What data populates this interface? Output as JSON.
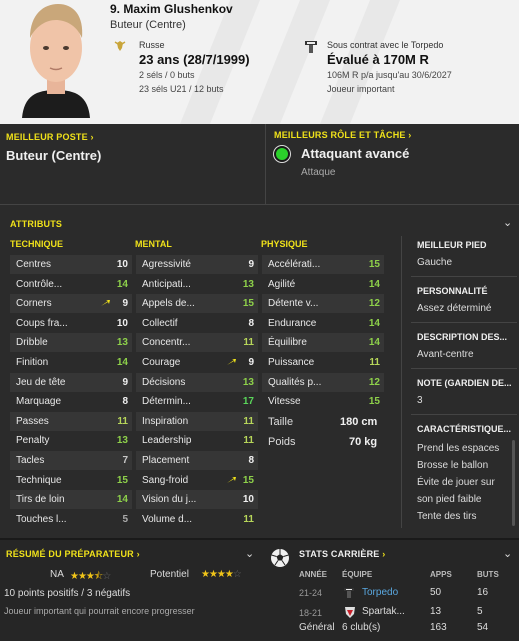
{
  "player": {
    "name": "9. Maxim Glushenkov",
    "position": "Buteur (Centre)",
    "nationality": "Russe",
    "age": "23 ans",
    "birth": "(28/7/1999)",
    "caps": "2 séls / 0 buts",
    "caps_u21": "23 séls U21 / 12 buts",
    "contract": "Sous contrat avec le Torpedo",
    "value": "Évalué à 170M R",
    "wage": "106M R p/a jusqu'au 30/6/2027",
    "status": "Joueur important"
  },
  "best_position": {
    "title": "MEILLEUR POSTE",
    "value": "Buteur (Centre)"
  },
  "best_role": {
    "title": "MEILLEURS RÔLE ET TÂCHE",
    "role": "Attaquant avancé",
    "duty": "Attaque"
  },
  "attributes": {
    "title": "ATTRIBUTS",
    "technique_title": "TECHNIQUE",
    "mental_title": "MENTAL",
    "physique_title": "PHYSIQUE",
    "technique": [
      {
        "name": "Centres",
        "value": "10"
      },
      {
        "name": "Contrôle...",
        "value": "14"
      },
      {
        "name": "Corners",
        "value": "9"
      },
      {
        "name": "Coups fra...",
        "value": "10"
      },
      {
        "name": "Dribble",
        "value": "13"
      },
      {
        "name": "Finition",
        "value": "14"
      },
      {
        "name": "Jeu de tête",
        "value": "9"
      },
      {
        "name": "Marquage",
        "value": "8"
      },
      {
        "name": "Passes",
        "value": "11"
      },
      {
        "name": "Penalty",
        "value": "13"
      },
      {
        "name": "Tacles",
        "value": "7"
      },
      {
        "name": "Technique",
        "value": "15"
      },
      {
        "name": "Tirs de loin",
        "value": "14"
      },
      {
        "name": "Touches l...",
        "value": "5"
      }
    ],
    "mental": [
      {
        "name": "Agressivité",
        "value": "9"
      },
      {
        "name": "Anticipati...",
        "value": "13"
      },
      {
        "name": "Appels de...",
        "value": "15"
      },
      {
        "name": "Collectif",
        "value": "8"
      },
      {
        "name": "Concentr...",
        "value": "11"
      },
      {
        "name": "Courage",
        "value": "9"
      },
      {
        "name": "Décisions",
        "value": "13"
      },
      {
        "name": "Détermin...",
        "value": "17"
      },
      {
        "name": "Inspiration",
        "value": "11"
      },
      {
        "name": "Leadership",
        "value": "11"
      },
      {
        "name": "Placement",
        "value": "8"
      },
      {
        "name": "Sang-froid",
        "value": "15"
      },
      {
        "name": "Vision du j...",
        "value": "10"
      },
      {
        "name": "Volume d...",
        "value": "11"
      }
    ],
    "physique": [
      {
        "name": "Accélérati...",
        "value": "15"
      },
      {
        "name": "Agilité",
        "value": "14"
      },
      {
        "name": "Détente v...",
        "value": "12"
      },
      {
        "name": "Endurance",
        "value": "14"
      },
      {
        "name": "Équilibre",
        "value": "14"
      },
      {
        "name": "Puissance",
        "value": "11"
      },
      {
        "name": "Qualités p...",
        "value": "12"
      },
      {
        "name": "Vitesse",
        "value": "15"
      }
    ],
    "height_label": "Taille",
    "height": "180 cm",
    "weight_label": "Poids",
    "weight": "70 kg"
  },
  "side": {
    "foot_title": "MEILLEUR PIED",
    "foot": "Gauche",
    "personality_title": "PERSONNALITÉ",
    "personality": "Assez déterminé",
    "desc_title": "DESCRIPTION DES...",
    "desc": "Avant-centre",
    "note_title": "NOTE (GARDIEN DE...",
    "note": "3",
    "traits_title": "CARACTÉRISTIQUE...",
    "traits": [
      "Prend les espaces",
      "Brosse le ballon",
      "Évite de jouer sur",
      "son pied faible",
      "Tente des tirs"
    ]
  },
  "coach": {
    "title": "RÉSUMÉ DU PRÉPARATEUR",
    "na_label": "NA",
    "na_stars": "3.5",
    "potential_label": "Potentiel",
    "potential_stars": "4",
    "points": "10 points positifs / 3 négatifs",
    "summary": "Joueur important qui pourrait encore progresser"
  },
  "career": {
    "title": "STATS CARRIÈRE",
    "headers": [
      "ANNÉE",
      "ÉQUIPE",
      "APPS",
      "BUTS"
    ],
    "rows": [
      {
        "year": "21-24",
        "team": "Torpedo",
        "apps": "50",
        "goals": "16"
      },
      {
        "year": "18-21",
        "team": "Spartak...",
        "apps": "13",
        "goals": "5"
      }
    ],
    "total_label": "Général",
    "total_clubs": "6 club(s)",
    "total_apps": "163",
    "total_goals": "54"
  },
  "colors": {
    "accent": "#f0e21a",
    "role_dot": "#2bd12b",
    "good": "#8ed14a"
  }
}
